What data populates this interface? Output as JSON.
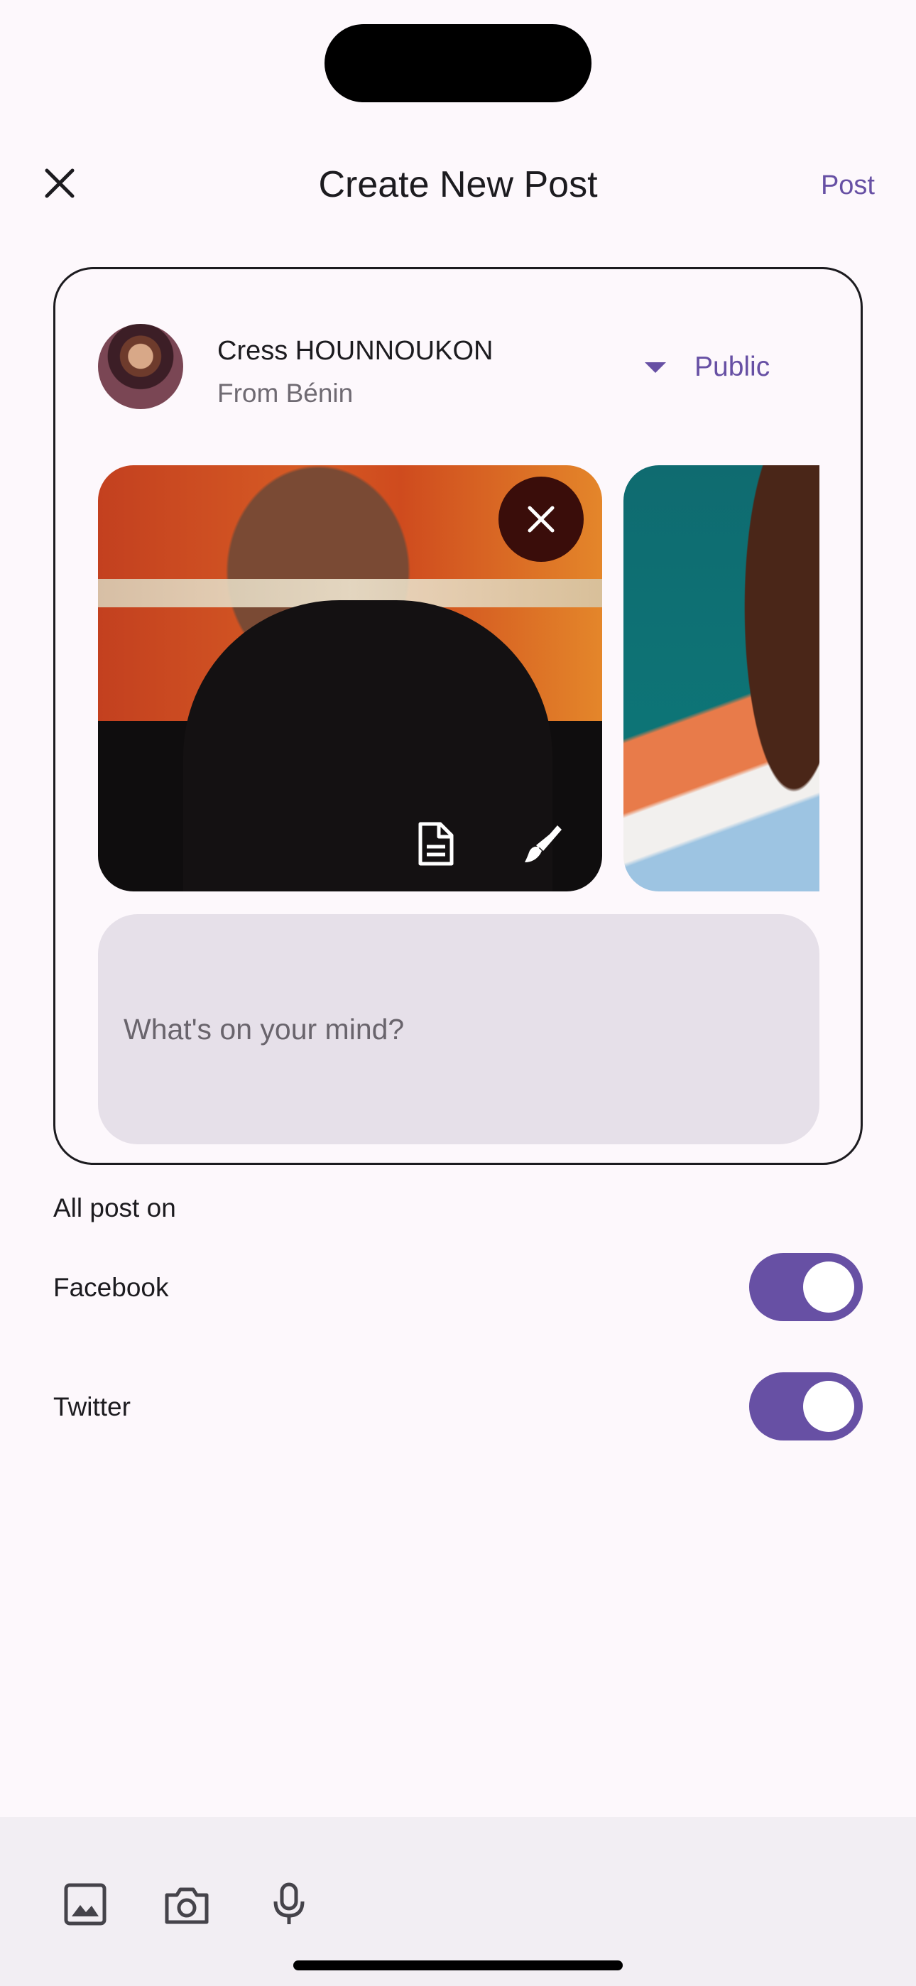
{
  "status_bar": {
    "island": "dynamic-island"
  },
  "app_bar": {
    "close_icon": "close-icon",
    "title": "Create New Post",
    "post_label": "Post"
  },
  "author": {
    "name": "Cress HOUNNOUKON",
    "origin": "From Bénin",
    "audience": "Public"
  },
  "media": {
    "items": [
      "photo-1",
      "photo-2"
    ],
    "remove_icon": "close-icon",
    "edit_icons": [
      "document-icon",
      "brush-icon"
    ]
  },
  "caption": {
    "placeholder": "What's on your mind?",
    "value": ""
  },
  "share": {
    "heading": "All post on",
    "targets": [
      {
        "label": "Facebook",
        "enabled": true
      },
      {
        "label": "Twitter",
        "enabled": true
      }
    ]
  },
  "toolbar": {
    "tools": [
      "image-icon",
      "camera-icon",
      "microphone-icon"
    ]
  },
  "colors": {
    "accent": "#6750a4",
    "background": "#fdf8fc",
    "caption_fill": "#e6e0e9",
    "bottom_bar": "#f2eef3"
  }
}
